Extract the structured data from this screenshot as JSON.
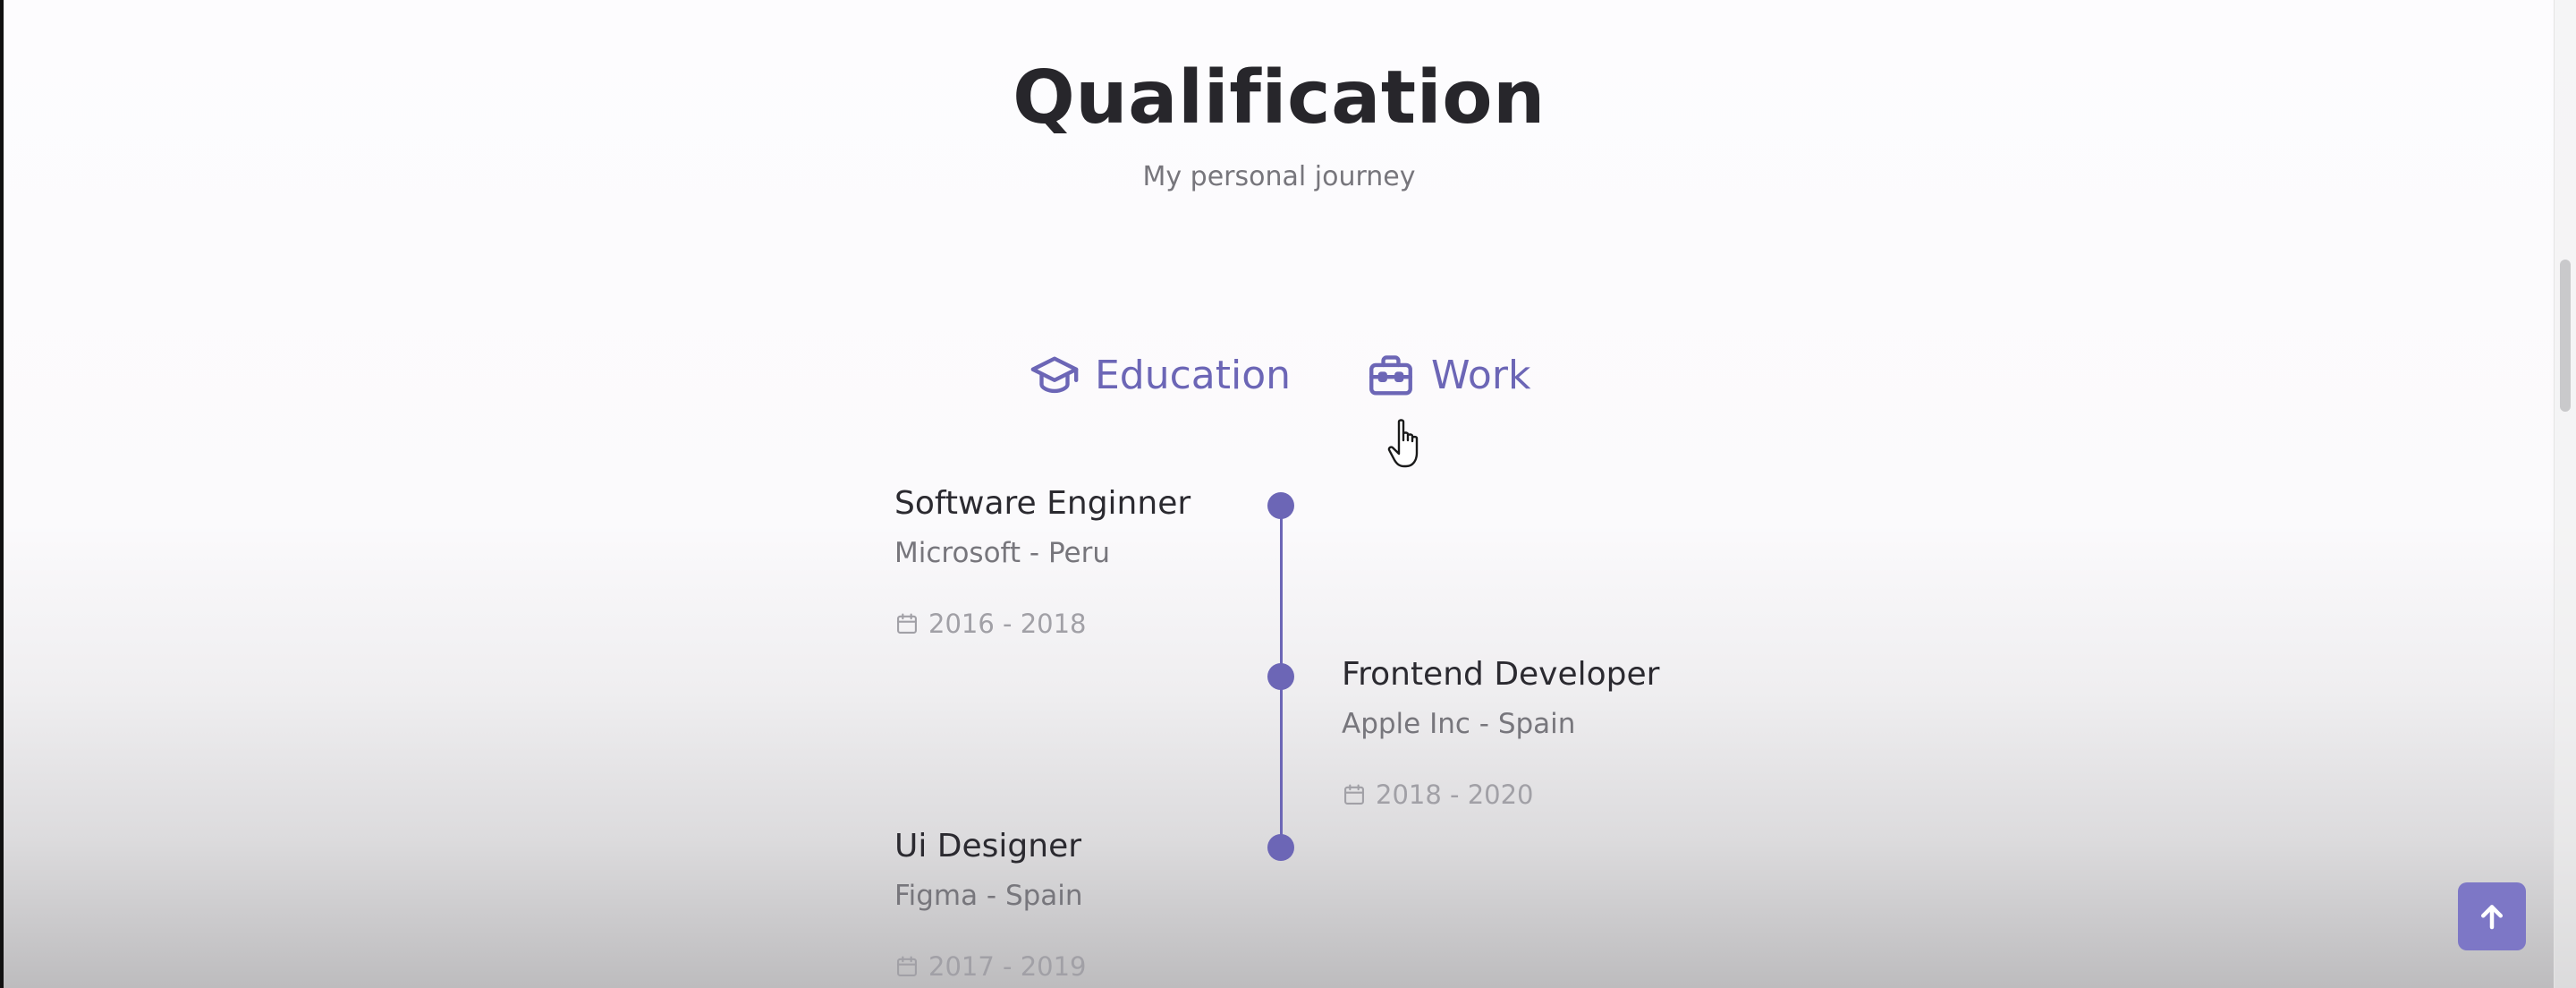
{
  "section": {
    "title": "Qualification",
    "subtitle": "My personal journey"
  },
  "tabs": [
    {
      "label": "Education",
      "icon": "graduation-cap-icon"
    },
    {
      "label": "Work",
      "icon": "briefcase-icon"
    }
  ],
  "timeline": [
    {
      "title": "Software Enginner",
      "subtitle": "Microsoft - Peru",
      "date": "2016 - 2018",
      "icon": "calendar-icon",
      "side": "left"
    },
    {
      "title": "Frontend Developer",
      "subtitle": "Apple Inc - Spain",
      "date": "2018 - 2020",
      "icon": "calendar-icon",
      "side": "right"
    },
    {
      "title": "Ui Designer",
      "subtitle": "Figma - Spain",
      "date": "2017 - 2019",
      "icon": "calendar-icon",
      "side": "left"
    }
  ],
  "scroll_up": {
    "icon": "arrow-up-icon"
  },
  "colors": {
    "accent": "#6c66b6",
    "scroll_up_bg": "#7d77c6",
    "title": "#27262b",
    "muted": "#77767c"
  }
}
